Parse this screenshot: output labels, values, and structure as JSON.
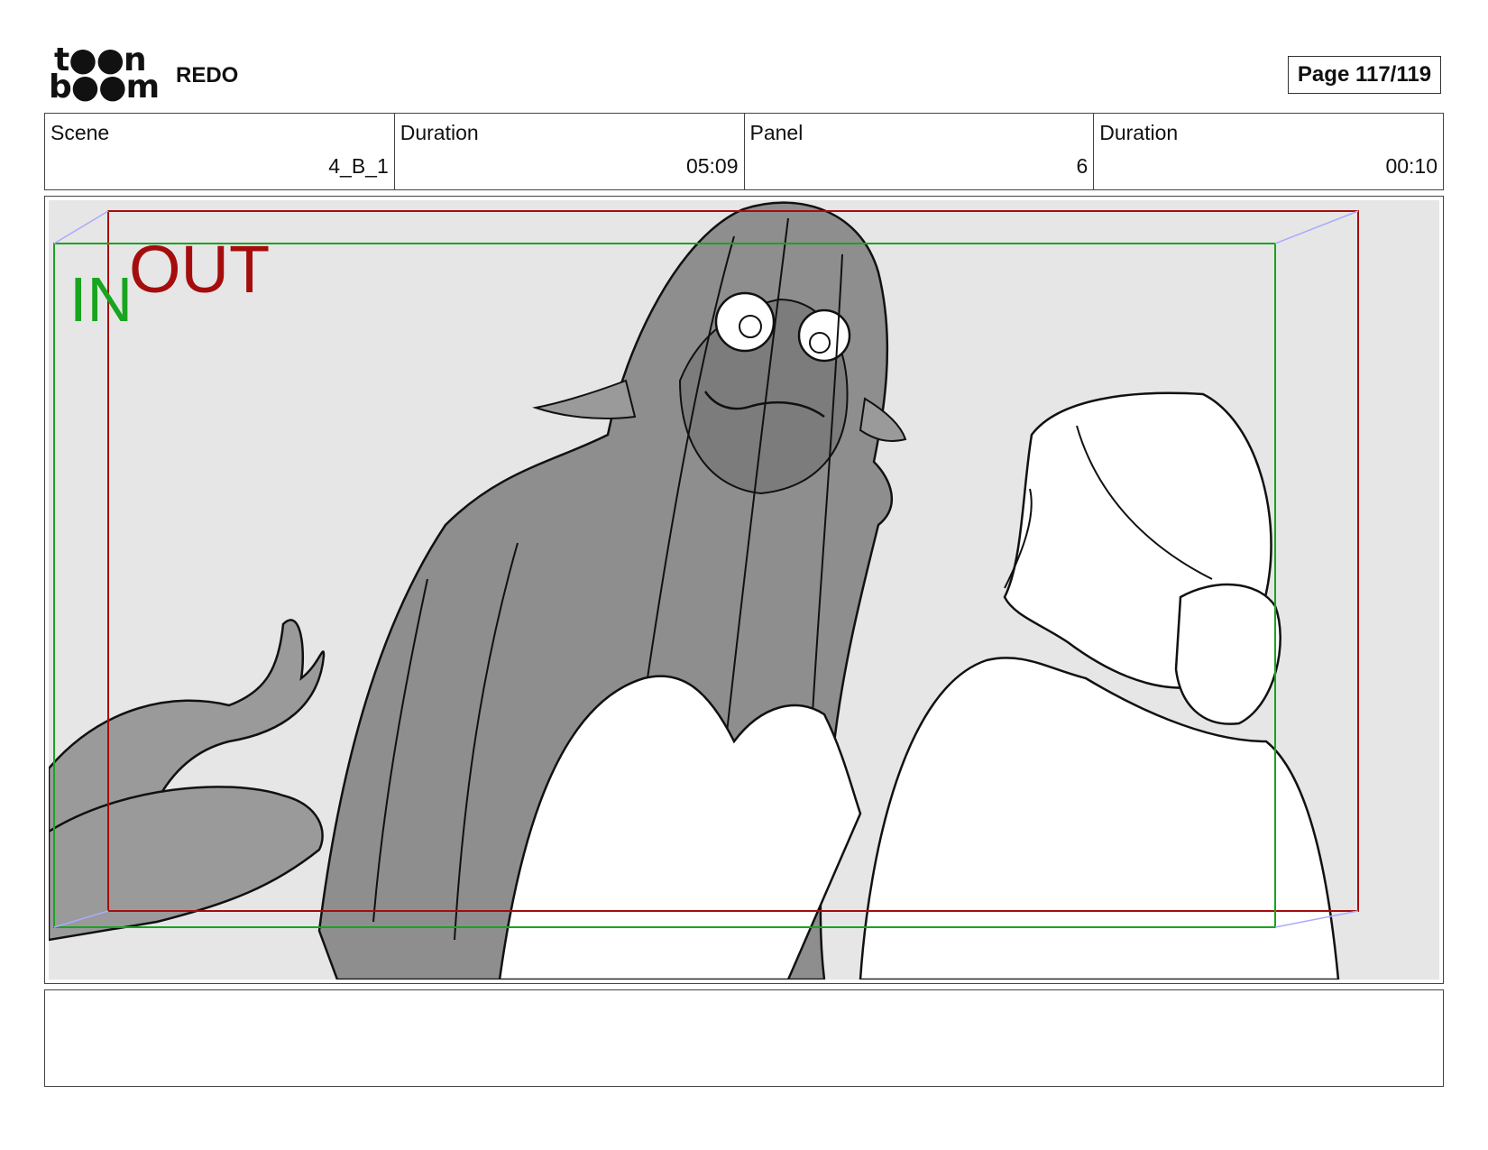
{
  "header": {
    "logo_top": "t●●n",
    "logo_bottom": "b●●m",
    "project_title": "REDO",
    "page_label": "Page 117/119"
  },
  "info": {
    "scene_label": "Scene",
    "scene_value": "4_B_1",
    "scene_duration_label": "Duration",
    "scene_duration_value": "05:09",
    "panel_label": "Panel",
    "panel_value": "6",
    "panel_duration_label": "Duration",
    "panel_duration_value": "00:10"
  },
  "camera": {
    "in_label": "IN",
    "out_label": "OUT",
    "in_color": "#19a41f",
    "out_color": "#a50d0d"
  },
  "notes": {
    "text": ""
  }
}
